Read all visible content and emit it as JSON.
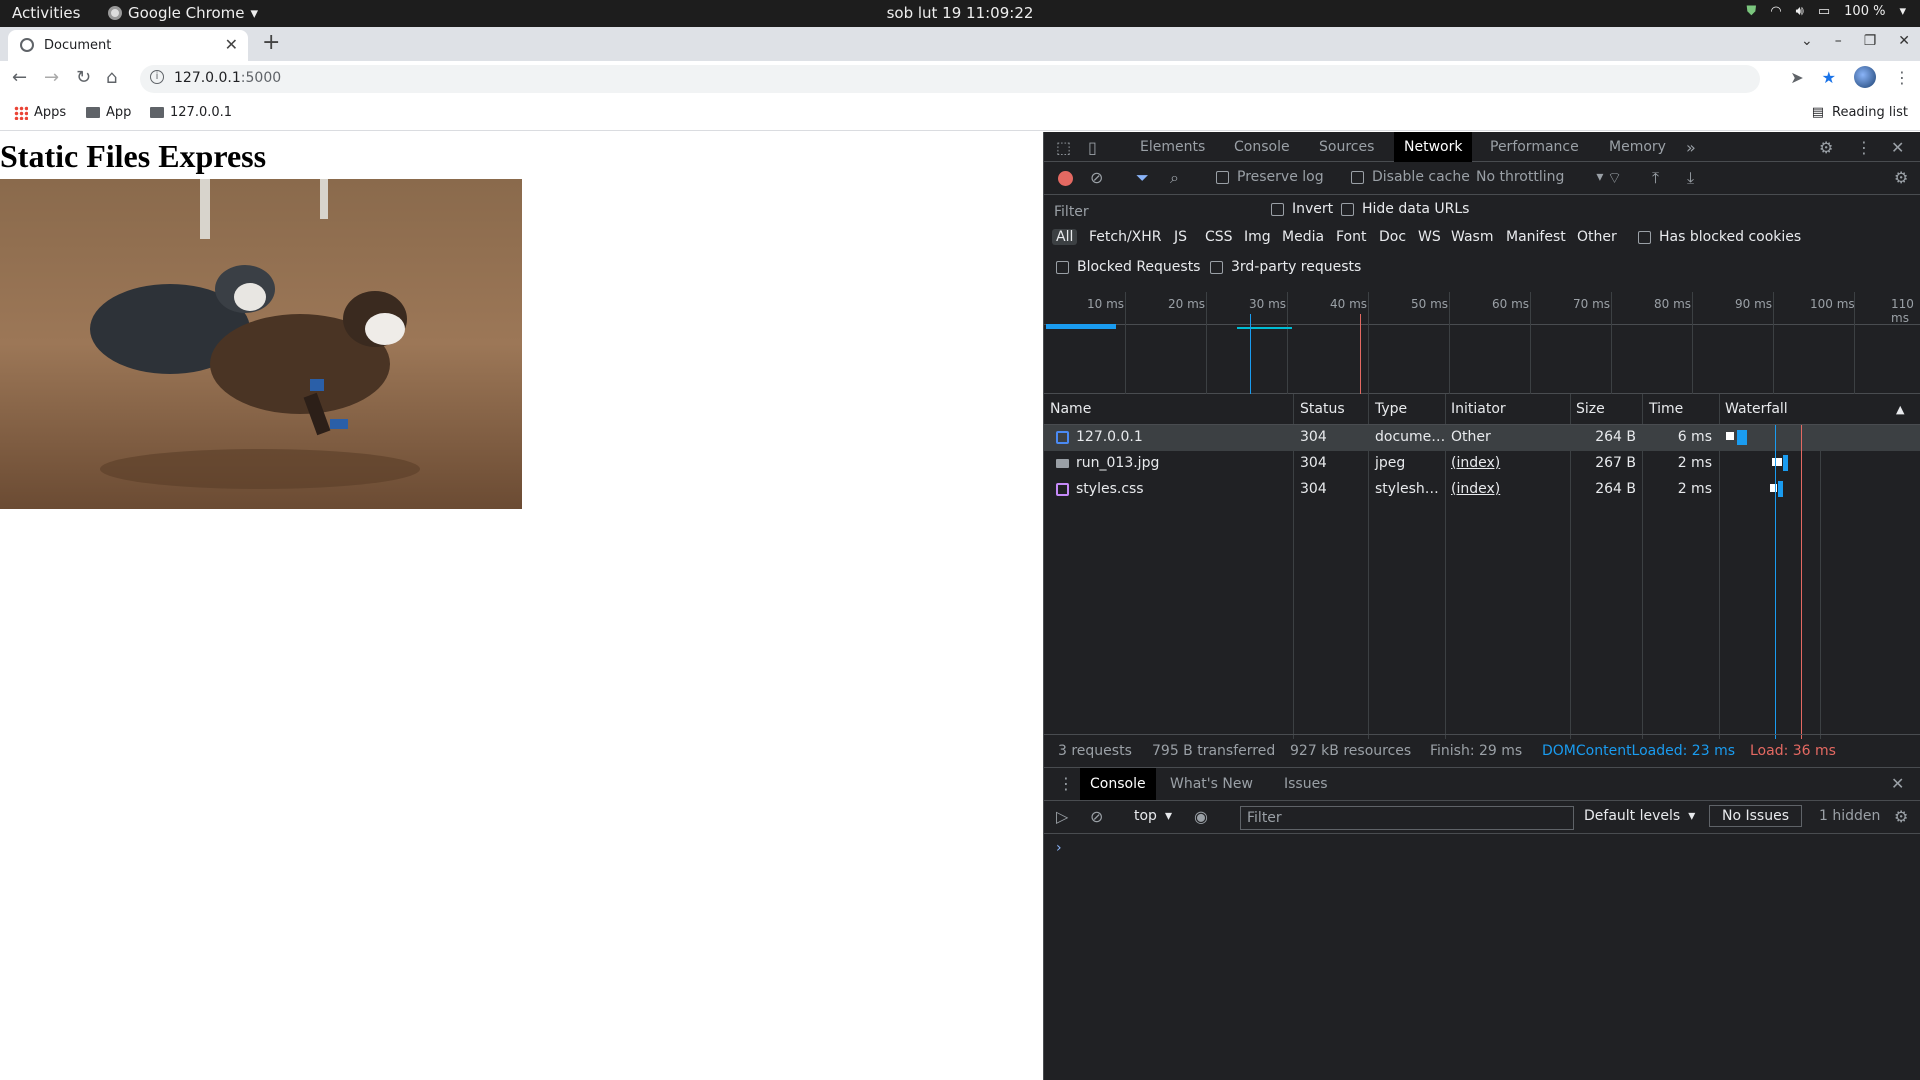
{
  "os": {
    "activities": "Activities",
    "app_name": "Google Chrome",
    "clock": "sob lut 19  11:09:22",
    "battery": "100 %"
  },
  "browser": {
    "tab_title": "Document",
    "url_host": "127.0.0.1",
    "url_port": ":5000",
    "bookmarks": [
      "Apps",
      "App",
      "127.0.0.1"
    ],
    "reading_list": "Reading list"
  },
  "page": {
    "heading": "Static Files Express"
  },
  "devtools": {
    "tabs": [
      "Elements",
      "Console",
      "Sources",
      "Network",
      "Performance",
      "Memory"
    ],
    "active_tab": "Network",
    "network_bar": {
      "preserve_log": "Preserve log",
      "disable_cache": "Disable cache",
      "throttling": "No throttling"
    },
    "filter": {
      "placeholder": "Filter",
      "invert": "Invert",
      "hide_data_urls": "Hide data URLs",
      "types": [
        "All",
        "Fetch/XHR",
        "JS",
        "CSS",
        "Img",
        "Media",
        "Font",
        "Doc",
        "WS",
        "Wasm",
        "Manifest",
        "Other"
      ],
      "has_blocked_cookies": "Has blocked cookies",
      "blocked_requests": "Blocked Requests",
      "third_party": "3rd-party requests"
    },
    "timeline_ticks": [
      "10 ms",
      "20 ms",
      "30 ms",
      "40 ms",
      "50 ms",
      "60 ms",
      "70 ms",
      "80 ms",
      "90 ms",
      "100 ms",
      "110 ms"
    ],
    "table": {
      "headers": [
        "Name",
        "Status",
        "Type",
        "Initiator",
        "Size",
        "Time",
        "Waterfall"
      ],
      "rows": [
        {
          "name": "127.0.0.1",
          "status": "304",
          "type": "docume…",
          "initiator": "Other",
          "size": "264 B",
          "time": "6 ms",
          "icon": "document-icon",
          "color": "#4a8af4"
        },
        {
          "name": "run_013.jpg",
          "status": "304",
          "type": "jpeg",
          "initiator": "(index)",
          "size": "267 B",
          "time": "2 ms",
          "icon": "image-icon",
          "color": "#9aa0a6"
        },
        {
          "name": "styles.css",
          "status": "304",
          "type": "stylesh…",
          "initiator": "(index)",
          "size": "264 B",
          "time": "2 ms",
          "icon": "stylesheet-icon",
          "color": "#c58af9"
        }
      ]
    },
    "status": {
      "requests": "3 requests",
      "transferred": "795 B transferred",
      "resources": "927 kB resources",
      "finish": "Finish: 29 ms",
      "dcl": "DOMContentLoaded: 23 ms",
      "load": "Load: 36 ms",
      "dcl_color": "#1a9cf0",
      "load_color": "#e46962"
    },
    "drawer": {
      "tabs": [
        "Console",
        "What's New",
        "Issues"
      ],
      "context": "top",
      "filter_placeholder": "Filter",
      "levels": "Default levels",
      "issues": "No Issues",
      "hidden": "1 hidden"
    }
  }
}
